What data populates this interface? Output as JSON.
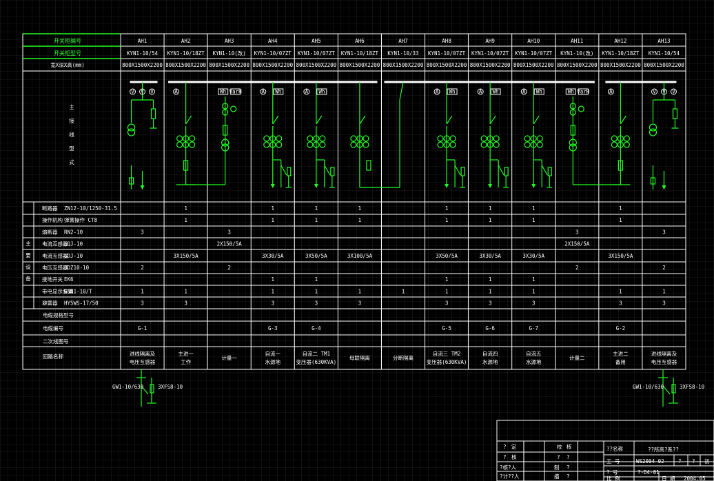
{
  "header": {
    "row1_label": "开关柜编号",
    "row2_label": "开关柜型号",
    "row3_label": "宽X深X高(mm)"
  },
  "cabinets": [
    {
      "id": "AH1",
      "model": "KYN1-10/54",
      "dims": "800X1500X2200"
    },
    {
      "id": "AH2",
      "model": "KYN1-10/18ZT",
      "dims": "800X1500X2200"
    },
    {
      "id": "AH3",
      "model": "KYN1-10(改)",
      "dims": "800X1500X2200"
    },
    {
      "id": "AH4",
      "model": "KYN1-10/07ZT",
      "dims": "800X1500X2200"
    },
    {
      "id": "AH5",
      "model": "KYN1-10/07ZT",
      "dims": "800X1500X2200"
    },
    {
      "id": "AH6",
      "model": "KYN1-10/18ZT",
      "dims": "800X1500X2200"
    },
    {
      "id": "AH7",
      "model": "KYN1-10/33",
      "dims": "800X1500X2200"
    },
    {
      "id": "AH8",
      "model": "KYN1-10/07ZT",
      "dims": "800X1500X2200"
    },
    {
      "id": "AH9",
      "model": "KYN1-10/07ZT",
      "dims": "800X1500X2200"
    },
    {
      "id": "AH10",
      "model": "KYN1-10/07ZT",
      "dims": "800X1500X2200"
    },
    {
      "id": "AH11",
      "model": "KYN1-10(改)",
      "dims": "800X1500X2200"
    },
    {
      "id": "AH12",
      "model": "KYN1-10/18ZT",
      "dims": "800X1500X2200"
    },
    {
      "id": "AH13",
      "model": "KYN1-10/54",
      "dims": "800X1500X2200"
    }
  ],
  "wiring_label": [
    "主",
    "接",
    "线",
    "型",
    "式"
  ],
  "equipment_group_label": [
    "主",
    "要",
    "设",
    "备"
  ],
  "equipment_rows": [
    {
      "name": "断路器",
      "spec": "ZN12-10/1250-31.5",
      "values": [
        "",
        "1",
        "",
        "1",
        "1",
        "1",
        "",
        "1",
        "1",
        "1",
        "",
        "1",
        ""
      ]
    },
    {
      "name": "操作机构",
      "spec": "弹簧操作 CT8",
      "values": [
        "",
        "1",
        "",
        "1",
        "1",
        "1",
        "",
        "1",
        "1",
        "1",
        "",
        "1",
        ""
      ]
    },
    {
      "name": "熔断器",
      "spec": "RN2-10",
      "values": [
        "3",
        "",
        "3",
        "",
        "",
        "",
        "",
        "",
        "",
        "",
        "3",
        "",
        "3"
      ]
    },
    {
      "name": "电流互感器",
      "spec": "LQJ-10",
      "values": [
        "",
        "",
        "2X150/5A",
        "",
        "",
        "",
        "",
        "",
        "",
        "",
        "2X150/5A",
        "",
        ""
      ]
    },
    {
      "name": "电流互感器",
      "spec": "LDJ-10",
      "values": [
        "",
        "3X150/5A",
        "",
        "3X30/5A",
        "3X50/5A",
        "3X100/5A",
        "",
        "3X50/5A",
        "3X30/5A",
        "3X30/5A",
        "",
        "3X150/5A",
        ""
      ]
    },
    {
      "name": "电压互感器",
      "spec": "JDZ10-10",
      "values": [
        "2",
        "",
        "2",
        "",
        "",
        "",
        "",
        "",
        "",
        "",
        "2",
        "",
        "2"
      ]
    },
    {
      "name": "接地开关",
      "spec": "EK6",
      "values": [
        "",
        "",
        "",
        "1",
        "1",
        "",
        "",
        "1",
        "1",
        "1",
        "",
        "",
        ""
      ]
    },
    {
      "name": "带电显示装置",
      "spec": "GSN1-10/T",
      "values": [
        "1",
        "1",
        "",
        "1",
        "1",
        "1",
        "1",
        "1",
        "1",
        "1",
        "",
        "1",
        "1"
      ]
    },
    {
      "name": "避雷器",
      "spec": "HY5WS-17/50",
      "values": [
        "3",
        "3",
        "",
        "3",
        "3",
        "3",
        "",
        "3",
        "3",
        "3",
        "",
        "3",
        "3"
      ]
    }
  ],
  "extra_rows": [
    {
      "label": "电缆规格型号",
      "values": [
        "",
        "",
        "",
        "",
        "",
        "",
        "",
        "",
        "",
        "",
        "",
        "",
        ""
      ]
    },
    {
      "label": "电缆编号",
      "values": [
        "G-1",
        "",
        "",
        "G-3",
        "G-4",
        "",
        "",
        "G-5",
        "G-6",
        "G-7",
        "",
        "G-2",
        ""
      ]
    },
    {
      "label": "二次线图号",
      "values": [
        "",
        "",
        "",
        "",
        "",
        "",
        "",
        "",
        "",
        "",
        "",
        "",
        ""
      ]
    }
  ],
  "circuit_row": {
    "label": "回路名称",
    "values": [
      [
        "进线隔离及",
        "电压互感器"
      ],
      [
        "主进一",
        "工作"
      ],
      [
        "计量一"
      ],
      [
        "自流一",
        "水源地"
      ],
      [
        "自流二 TM1",
        "变压器(630KVA)"
      ],
      [
        "母联隔离"
      ],
      [
        "分断隔离"
      ],
      [
        "自流三 TM2",
        "变压器(630KVA)"
      ],
      [
        "自流四",
        "水源地"
      ],
      [
        "自流五",
        "水源地"
      ],
      [
        "计量二"
      ],
      [
        "主进二",
        "备用"
      ],
      [
        "进线隔离及",
        "电压互感器"
      ]
    ]
  },
  "incoming": {
    "left_label1": "GW1-10/630",
    "left_label2": "3XFS8-10",
    "right_label1": "GW1-10/630",
    "right_label2": "3XFS8-10"
  },
  "title_block": {
    "r1": [
      "?",
      "定",
      "校",
      "核"
    ],
    "r2": [
      "?",
      "核",
      "?",
      "?"
    ],
    "r3": [
      "?核?人",
      "制",
      "?"
    ],
    "r4": [
      "?计??人",
      "描",
      "?"
    ],
    "project_label": "??名称",
    "project_name": "??所高?系??",
    "job_label": "工   号",
    "job_value": "WS2004-02",
    "sheet_marks": [
      "?",
      "?",
      "?",
      "?",
      "初"
    ],
    "drawing_label": "?   号",
    "drawing_value": "?-D4-01",
    "scale_label": "比   例",
    "date_label": "日   期",
    "date_value": "2004.05"
  },
  "colors": {
    "background": "#000000",
    "grid": "#3a3a3a",
    "lines": "#ffffff",
    "green": "#22ff22"
  }
}
